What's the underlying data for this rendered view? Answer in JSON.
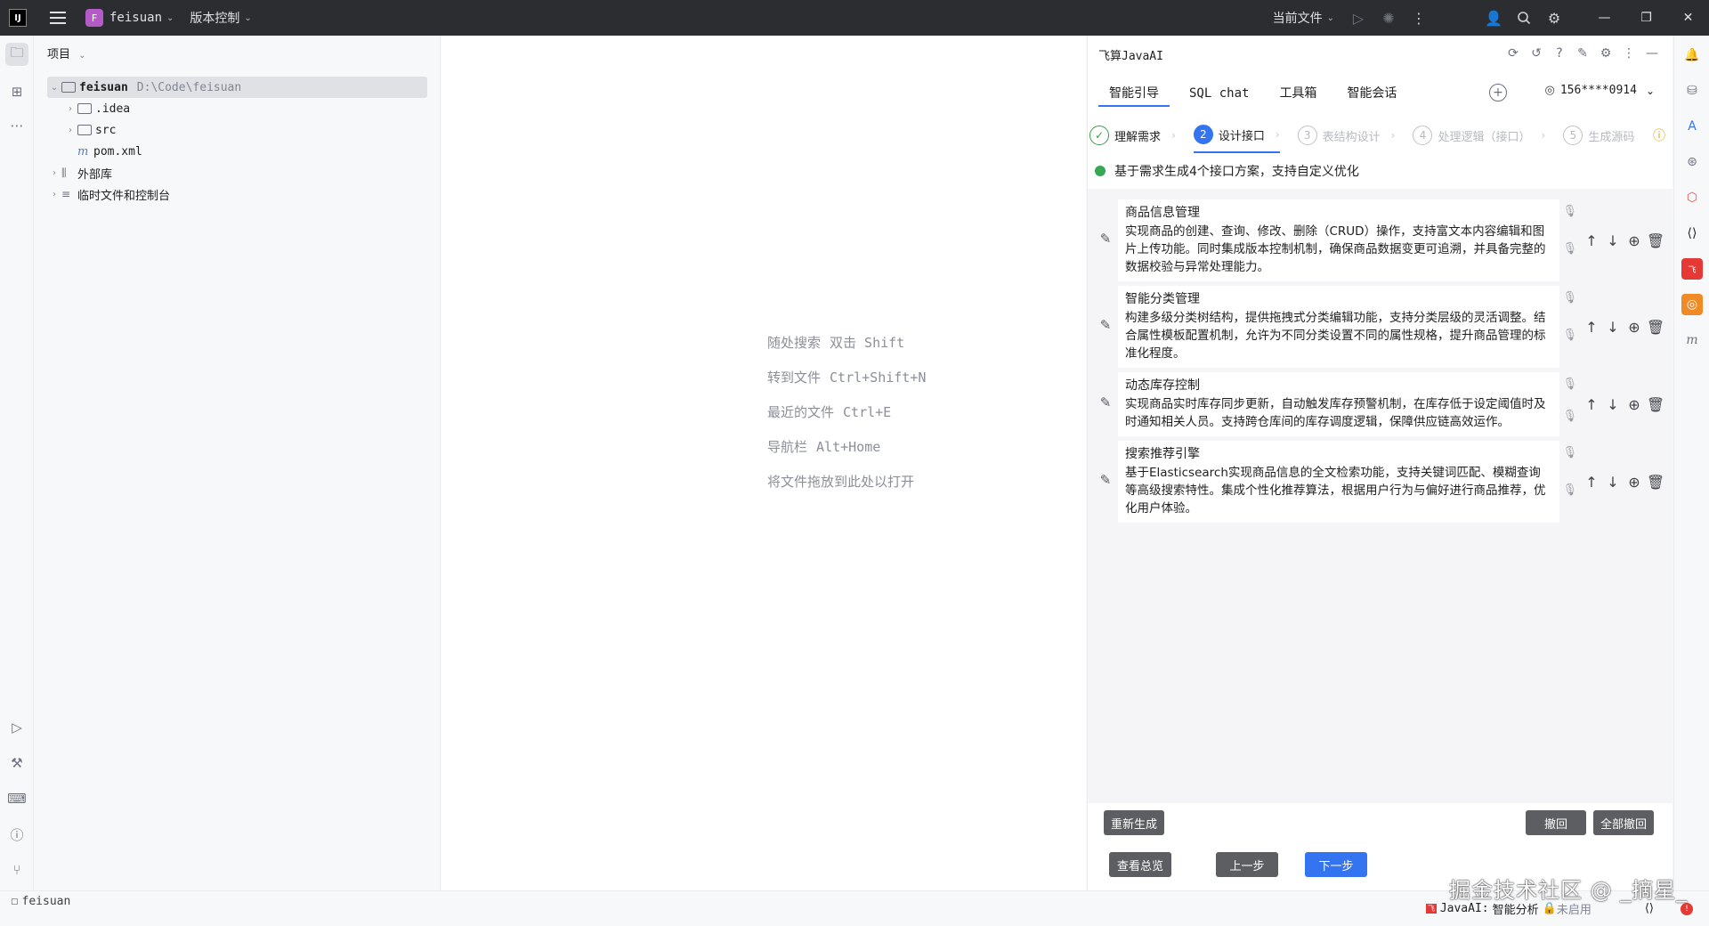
{
  "titlebar": {
    "logo_text": "IJ",
    "project_badge": "F",
    "project_name": "feisuan",
    "vcs_label": "版本控制",
    "run_config": "当前文件"
  },
  "project_panel": {
    "title": "项目",
    "tree": [
      {
        "label": "feisuan",
        "path": "D:\\Code\\feisuan"
      },
      {
        "label": ".idea"
      },
      {
        "label": "src"
      },
      {
        "label": "pom.xml",
        "icon": "m"
      },
      {
        "label": "外部库"
      },
      {
        "label": "临时文件和控制台"
      }
    ]
  },
  "editor": {
    "hints": [
      {
        "text": "随处搜索",
        "key": "双击 Shift"
      },
      {
        "text": "转到文件",
        "key": "Ctrl+Shift+N"
      },
      {
        "text": "最近的文件",
        "key": "Ctrl+E"
      },
      {
        "text": "导航栏",
        "key": "Alt+Home"
      },
      {
        "text": "将文件拖放到此处以打开",
        "key": ""
      }
    ]
  },
  "ai_panel": {
    "title": "飞算JavaAI",
    "tabs": [
      "智能引导",
      "SQL chat",
      "工具箱",
      "智能会话"
    ],
    "user": "156****0914",
    "steps": [
      {
        "num": "✓",
        "label": "理解需求"
      },
      {
        "num": "2",
        "label": "设计接口"
      },
      {
        "num": "3",
        "label": "表结构设计"
      },
      {
        "num": "4",
        "label": "处理逻辑（接口）"
      },
      {
        "num": "5",
        "label": "生成源码"
      }
    ],
    "status": "基于需求生成4个接口方案，支持自定义优化",
    "items": [
      {
        "title": "商品信息管理",
        "desc": "实现商品的创建、查询、修改、删除（CRUD）操作，支持富文本内容编辑和图片上传功能。同时集成版本控制机制，确保商品数据变更可追溯，并具备完整的数据校验与异常处理能力。"
      },
      {
        "title": "智能分类管理",
        "desc": "构建多级分类树结构，提供拖拽式分类编辑功能，支持分类层级的灵活调整。结合属性模板配置机制，允许为不同分类设置不同的属性规格，提升商品管理的标准化程度。"
      },
      {
        "title": "动态库存控制",
        "desc": "实现商品实时库存同步更新，自动触发库存预警机制，在库存低于设定阈值时及时通知相关人员。支持跨仓库间的库存调度逻辑，保障供应链高效运作。"
      },
      {
        "title": "搜索推荐引擎",
        "desc": "基于Elasticsearch实现商品信息的全文检索功能，支持关键词匹配、模糊查询等高级搜索特性。集成个性化推荐算法，根据用户行为与偏好进行商品推荐，优化用户体验。"
      }
    ],
    "buttons": {
      "regenerate": "重新生成",
      "undo": "撤回",
      "undo_all": "全部撤回",
      "overview": "查看总览",
      "prev": "上一步",
      "next": "下一步"
    }
  },
  "statusbar": {
    "project": "feisuan",
    "plugin_prefix": "JavaAI:",
    "plugin_label": "智能分析",
    "plugin_state": "未启用"
  },
  "watermark": "掘金技术社区 @ _摘星_",
  "colors": {
    "accent": "#3574f0",
    "titlebar": "#2b2d30",
    "success": "#34a853"
  }
}
